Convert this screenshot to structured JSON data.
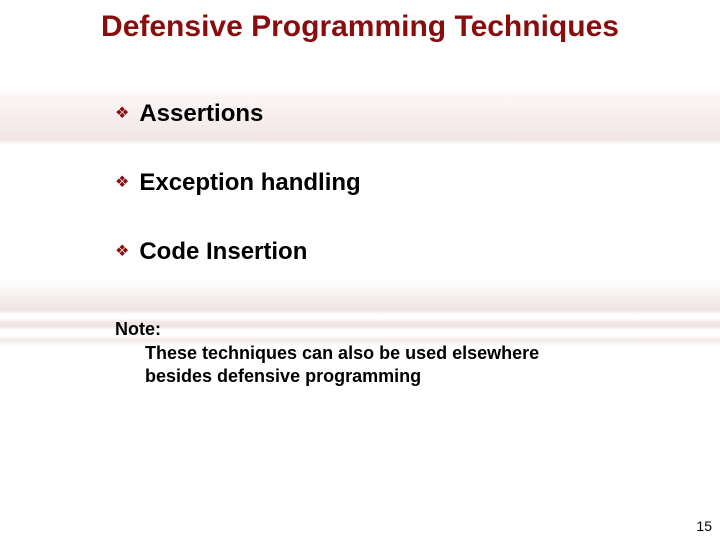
{
  "title": "Defensive Programming Techniques",
  "bullets": {
    "b0": "Assertions",
    "b1": "Exception handling",
    "b2": "Code Insertion"
  },
  "note": {
    "label": "Note:",
    "line1": "These techniques can also be used elsewhere",
    "line2": "besides defensive programming"
  },
  "page_number": "15",
  "bullet_glyph": "❖"
}
